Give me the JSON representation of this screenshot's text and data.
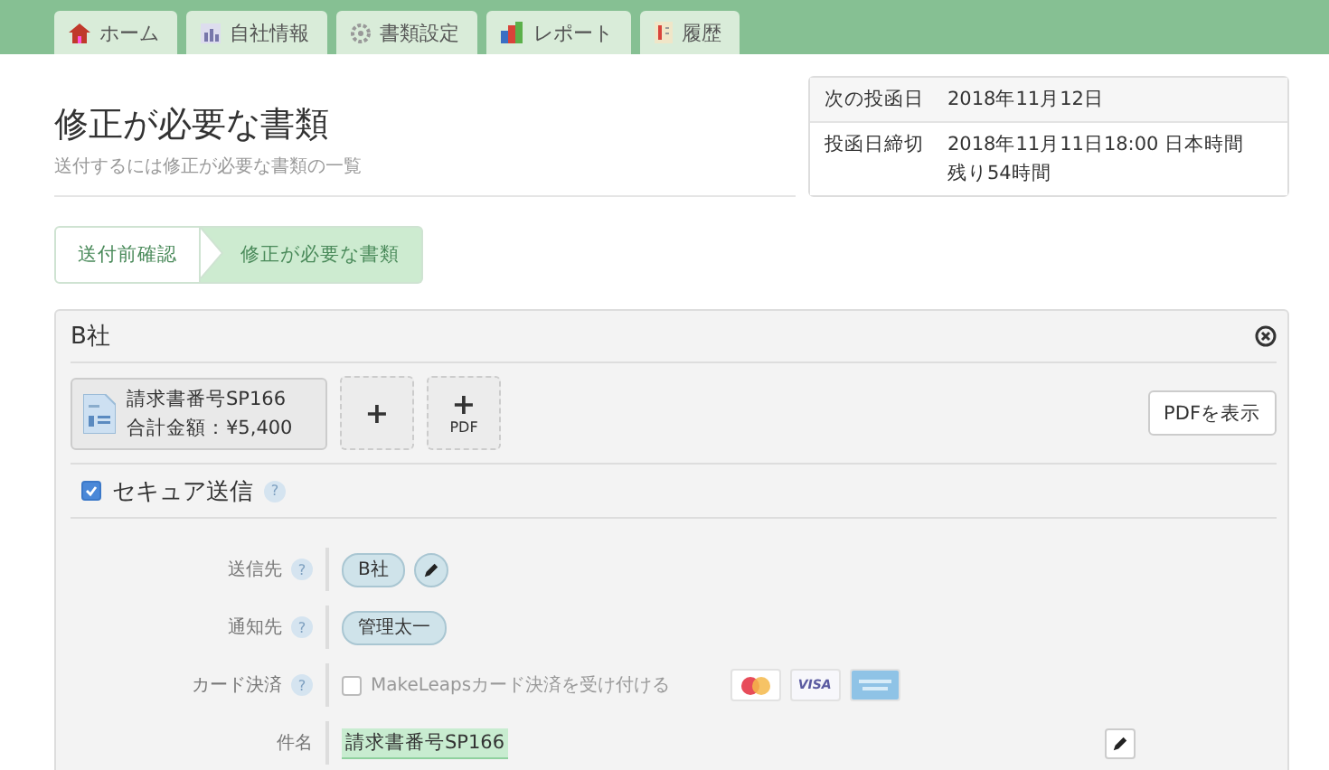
{
  "nav_tabs": [
    {
      "label": "ホーム"
    },
    {
      "label": "自社情報"
    },
    {
      "label": "書類設定"
    },
    {
      "label": "レポート"
    },
    {
      "label": "履歴"
    }
  ],
  "page": {
    "title": "修正が必要な書類",
    "subtitle": "送付するには修正が必要な書類の一覧"
  },
  "schedule": [
    {
      "label": "次の投函日",
      "lines": [
        "2018年11月12日"
      ]
    },
    {
      "label": "投函日締切",
      "lines": [
        "2018年11月11日18:00 日本時間",
        "残り54時間"
      ]
    }
  ],
  "steps": [
    {
      "label": "送付前確認",
      "selected": false
    },
    {
      "label": "修正が必要な書類",
      "selected": true
    }
  ],
  "card": {
    "title": "B社",
    "document": {
      "name": "請求書番号SP166",
      "total": "合計金額：¥5,400"
    },
    "add_buttons": [
      {
        "kind": "plain",
        "symbol": "+"
      },
      {
        "kind": "pdf",
        "symbol": "+",
        "label": "PDF"
      }
    ],
    "pdf_button": "PDFを表示",
    "secure": {
      "label": "セキュア送信",
      "checked": true,
      "help": "?"
    },
    "fields": [
      {
        "kind": "tags",
        "label": "送信先",
        "help": "?",
        "tags": [
          "B社"
        ],
        "editable": true
      },
      {
        "kind": "tags",
        "label": "通知先",
        "help": "?",
        "tags": [
          "管理太一"
        ],
        "editable": false
      },
      {
        "kind": "checkbox",
        "label": "カード決済",
        "help": "?",
        "option": "MakeLeapsカード決済を受け付ける",
        "checked": false,
        "cards": [
          {
            "kind": "circles"
          },
          {
            "kind": "word",
            "label": "VISA"
          },
          {
            "kind": "stripes"
          }
        ]
      },
      {
        "kind": "text",
        "label": "件名",
        "value": "請求書番号SP166"
      }
    ]
  }
}
